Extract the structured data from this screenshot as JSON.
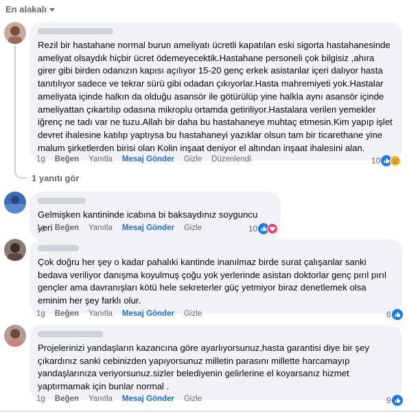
{
  "sort": {
    "label": "En alakalı"
  },
  "comments": [
    {
      "text": "Rezil bir hastahane normal burun ameliyatı ücretli kapatılan eski sigorta hastahanesinde ameliyat olsaydık hiçbir ücret ödemeyecektik.Hastahane personeli çok bilgisiz ,ahıra girer gibi birden odanızın kapısı açılıyor 15-20 genç erkek asistanlar içeri dalıyor hasta tanıtılıyor sadece ve tekrar sürü gibi odadan çıkıyorlar.Hasta mahremiyeti yok.Hastalar ameliyata içinde halkın da olduğu asansör ile götürülüp yine halkla aynı asansör içinde ameliyattan çıkartılıp odasına mikroplu ortamda getiriliyor.Hastalara verilen yemekler iğrenç ne tadı var ne tuzu.Allah bir daha bu hastahaneye muhtaç etmesin.Kim yapıp işlet devret ihalesine katılıp yaptıysa bu hastahaneyi yazıklar olsun tam bir ticarethane yine malum şirketlerden birisi olan Kolin inşaat deniyor el altından inşaat ihalesini alan.",
      "time": "1g",
      "like": "Beğen",
      "reply": "Yanıtla",
      "message": "Mesaj Gönder",
      "hide": "Gizle",
      "edited": "Düzenlendi",
      "reactions": "10"
    },
    {
      "text": "Gelmişken kantininde icabına bi baksaydınız soyguncu yeri",
      "time": "1g",
      "like": "Beğen",
      "reply": "Yanıtla",
      "message": "Mesaj Gönder",
      "hide": "Gizle",
      "reactions": "10"
    },
    {
      "text": "Çok doğru her şey o kadar pahalıki kantinde inanılmaz birde surat çalışanlar sanki bedava veriliyor danışma koyulmuş çoğu yok yerlerinde asistan doktorlar genç pırıl pırıl gençler ama davranışları kötü hele sekreterler güç yetmiyor biraz denetlemek olsa eminim her şey farklı olur.",
      "time": "1g",
      "like": "Beğen",
      "reply": "Yanıtla",
      "message": "Mesaj Gönder",
      "hide": "Gizle",
      "reactions": "6"
    },
    {
      "text": "Projelerinizi yandaşların kazancına göre ayarlıyorsunuz,hasta garantisi diye bir şey çıkardınız sanki cebinizden yapıyorsunuz milletin parasını millette harcamayıp yandaşlarınıza veriyorsunuz.sizler belediyenin gelirlerine el koyarsanız hizmet yaptırmamak için bunlar normal .",
      "time": "1g",
      "like": "Beğen",
      "reply": "Yanıtla",
      "message": "Mesaj Gönder",
      "hide": "Gizle",
      "reactions": "9"
    }
  ],
  "replies_link": "1 yanıtı gör",
  "colors": {
    "like": "#1877f2",
    "love": "#f33e58",
    "sad": "#f7b125",
    "link": "#216fdb",
    "muted": "#65676b"
  }
}
